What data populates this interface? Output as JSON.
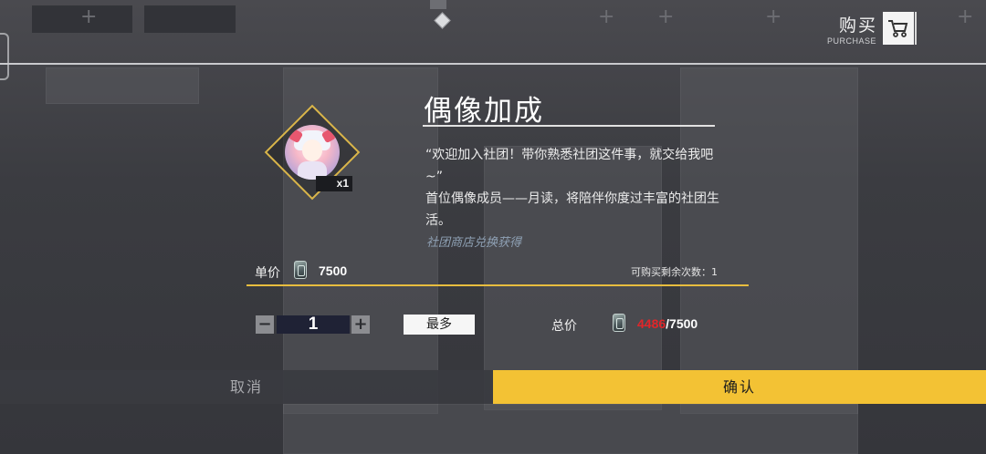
{
  "header": {
    "title": "购买",
    "subtitle": "PURCHASE",
    "cart_icon": "cart-icon"
  },
  "item": {
    "name": "偶像加成",
    "quantity_badge": "x1",
    "description_lines": [
      "“欢迎加入社团！带你熟悉社团这件事，就交给我吧~”",
      "首位偶像成员——月读，将陪伴你度过丰富的社团生活。"
    ],
    "source": "社团商店兑换获得"
  },
  "price": {
    "unit_label": "单价",
    "unit_value": "7500",
    "currency_icon": "club-coin-icon",
    "remaining_label": "可购买剩余次数：1"
  },
  "quantity": {
    "minus": "−",
    "value": "1",
    "plus": "+",
    "max_label": "最多"
  },
  "total": {
    "label": "总价",
    "owned": "4486",
    "separator_total": "/7500"
  },
  "actions": {
    "cancel": "取消",
    "confirm": "确认"
  },
  "colors": {
    "accent_yellow": "#f3c234",
    "insufficient_red": "#e0262a"
  }
}
